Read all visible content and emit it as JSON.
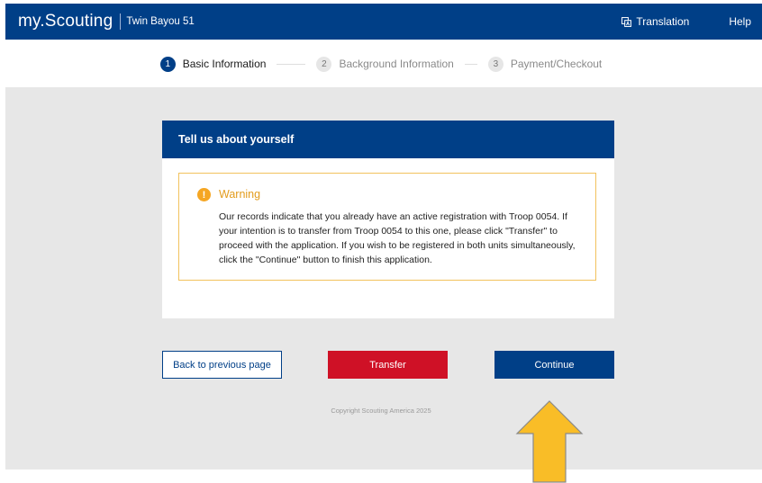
{
  "header": {
    "brand": "my.Scouting",
    "unit_name": "Twin Bayou 51",
    "translation_label": "Translation",
    "translation_icon": "translate-icon",
    "help_label": "Help",
    "bar_color": "#003f87"
  },
  "stepper": {
    "steps": [
      {
        "number": "1",
        "label": "Basic Information",
        "state": "active"
      },
      {
        "number": "2",
        "label": "Background Information",
        "state": "inactive"
      },
      {
        "number": "3",
        "label": "Payment/Checkout",
        "state": "inactive"
      }
    ]
  },
  "card": {
    "title": "Tell us about yourself",
    "warning": {
      "icon": "exclamation-icon",
      "title": "Warning",
      "message": "Our records indicate that you already have an active registration with Troop 0054. If your intention is to transfer from Troop 0054 to this one, please click \"Transfer\" to proceed with the application. If you wish to be registered in both units simultaneously, click the \"Continue\" button to finish this application."
    }
  },
  "actions": {
    "back_label": "Back to previous page",
    "transfer_label": "Transfer",
    "continue_label": "Continue",
    "transfer_color": "#cf1126",
    "continue_color": "#003f87"
  },
  "footer": {
    "copyright": "Copyright Scouting America 2025"
  },
  "annotation": {
    "arrow_color": "#f9bd27"
  }
}
